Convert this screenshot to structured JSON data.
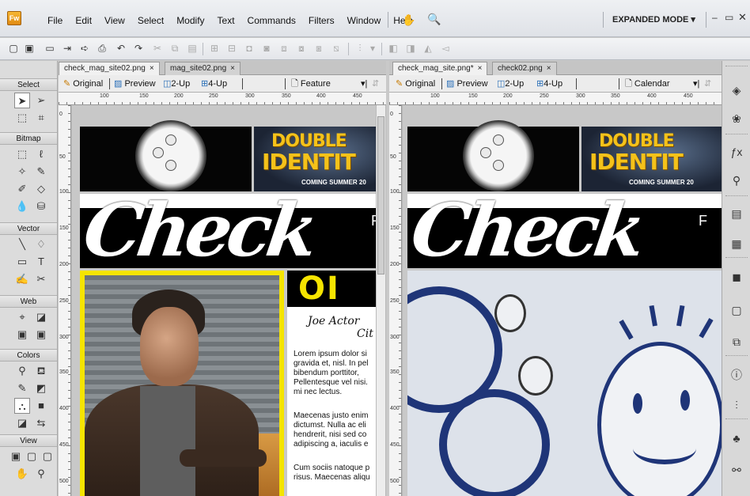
{
  "app": {
    "logo_text": "Fw",
    "menus": [
      "File",
      "Edit",
      "View",
      "Select",
      "Modify",
      "Text",
      "Commands",
      "Filters",
      "Window",
      "Help"
    ],
    "mode": "EXPANDED MODE ▾",
    "window_controls": [
      "–",
      "▭",
      "✕"
    ]
  },
  "tools": {
    "sections": [
      "Select",
      "Bitmap",
      "Vector",
      "Web",
      "Colors",
      "View"
    ]
  },
  "left_doc": {
    "tabs": [
      {
        "label": "check_mag_site02.png",
        "close": "×"
      },
      {
        "label": "mag_site02.png",
        "close": "×"
      }
    ],
    "views": [
      "Original",
      "Preview",
      "2-Up",
      "4-Up"
    ],
    "page_select": "Feature",
    "ruler_h": [
      "100",
      "150",
      "200",
      "250",
      "300",
      "350",
      "400",
      "450"
    ],
    "ruler_v": [
      "0",
      "50",
      "100",
      "150",
      "200",
      "250",
      "300",
      "350",
      "400",
      "450",
      "500"
    ]
  },
  "right_doc": {
    "tabs": [
      {
        "label": "check_mag_site.png*",
        "close": "×"
      },
      {
        "label": "check02.png",
        "close": "×"
      }
    ],
    "views": [
      "Original",
      "Preview",
      "2-Up",
      "4-Up"
    ],
    "page_select": "Calendar",
    "ruler_h": [
      "100",
      "150",
      "200",
      "250",
      "300",
      "350",
      "400",
      "450"
    ],
    "ruler_v": [
      "0",
      "50",
      "100",
      "150",
      "200",
      "250",
      "300",
      "350",
      "400",
      "450",
      "500"
    ]
  },
  "artwork": {
    "movie_line1": "DOUBLE",
    "movie_line2": "IDENTIT",
    "movie_line3": "COMING SUMMER 20",
    "masthead": "Check",
    "masthead_suffix": "F",
    "article_logo": "OI",
    "byline_1": "Joe Actor",
    "byline_2": "Cit",
    "para1": "Lorem ipsum dolor si\ngravida et, nisl. In pel\nbibendum porttitor, \nPellentesque vel nisi.\nmi nec lectus.",
    "para2": "Maecenas justo enim\ndictumst. Nulla ac eli\nhendrerit, nisi sed co\nadipiscing a, iaculis e",
    "para3": "Cum sociis natoque p\nrisus. Maecenas aliqu"
  }
}
